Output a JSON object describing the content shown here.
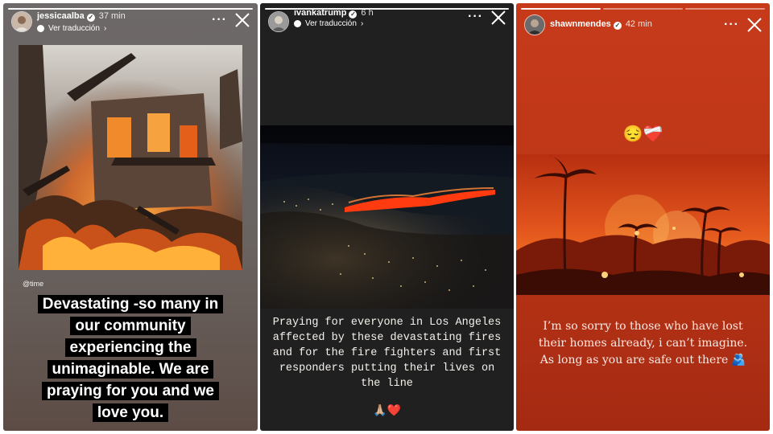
{
  "stories": [
    {
      "username": "jessicaalba",
      "time": "37 min",
      "translate_label": "Ver traducción",
      "credit": "@time",
      "caption_lines": [
        "Devastating -so many in",
        "our community",
        "experiencing the",
        "unimaginable. We are",
        "praying for you and we",
        "love you."
      ]
    },
    {
      "username": "ivankatrump",
      "time": "6 h",
      "translate_label": "Ver traducción",
      "caption": "Praying for everyone in Los Angeles affected by these devastating fires and for the fire fighters and first responders putting their lives on the line",
      "emoji": "🙏🏼❤️"
    },
    {
      "username": "shawnmendes",
      "time": "42 min",
      "emoji_top": "😔❤️‍🩹",
      "caption": "I’m so sorry to those who have lost their homes already, i can’t imagine. As long as you are safe out there 🫂"
    }
  ],
  "icons": {
    "verified": "verified-badge-icon",
    "translate": "globe-icon",
    "chevron": "chevron-right-icon",
    "more": "more-options-icon",
    "close": "close-icon"
  },
  "colors": {
    "story1_bg": "#6a6461",
    "story2_bg": "#212021",
    "story3_bg": "#c63a1a",
    "fire": "#ff3b0f"
  }
}
